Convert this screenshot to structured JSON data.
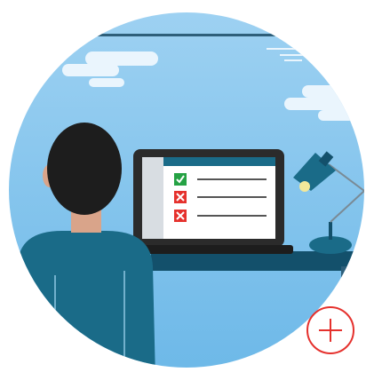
{
  "scene": {
    "subject": "person-at-laptop",
    "icons": {
      "checklist_row_1": "check-icon",
      "checklist_row_2": "cross-icon",
      "checklist_row_3": "cross-icon",
      "add_button": "plus-icon"
    }
  },
  "colors": {
    "sky": "#7ec3ee",
    "sky_light": "#bde1f7",
    "cloud": "#eaf5fd",
    "teal_dark": "#13506b",
    "teal": "#1a6b88",
    "laptop_body": "#2b2b2b",
    "skin": "#d9a48a",
    "hair": "#1d1d1d",
    "check_green": "#25a244",
    "cross_red": "#e5312d",
    "lamp_glow": "#f3e89a",
    "accent_red": "#e5312d"
  }
}
